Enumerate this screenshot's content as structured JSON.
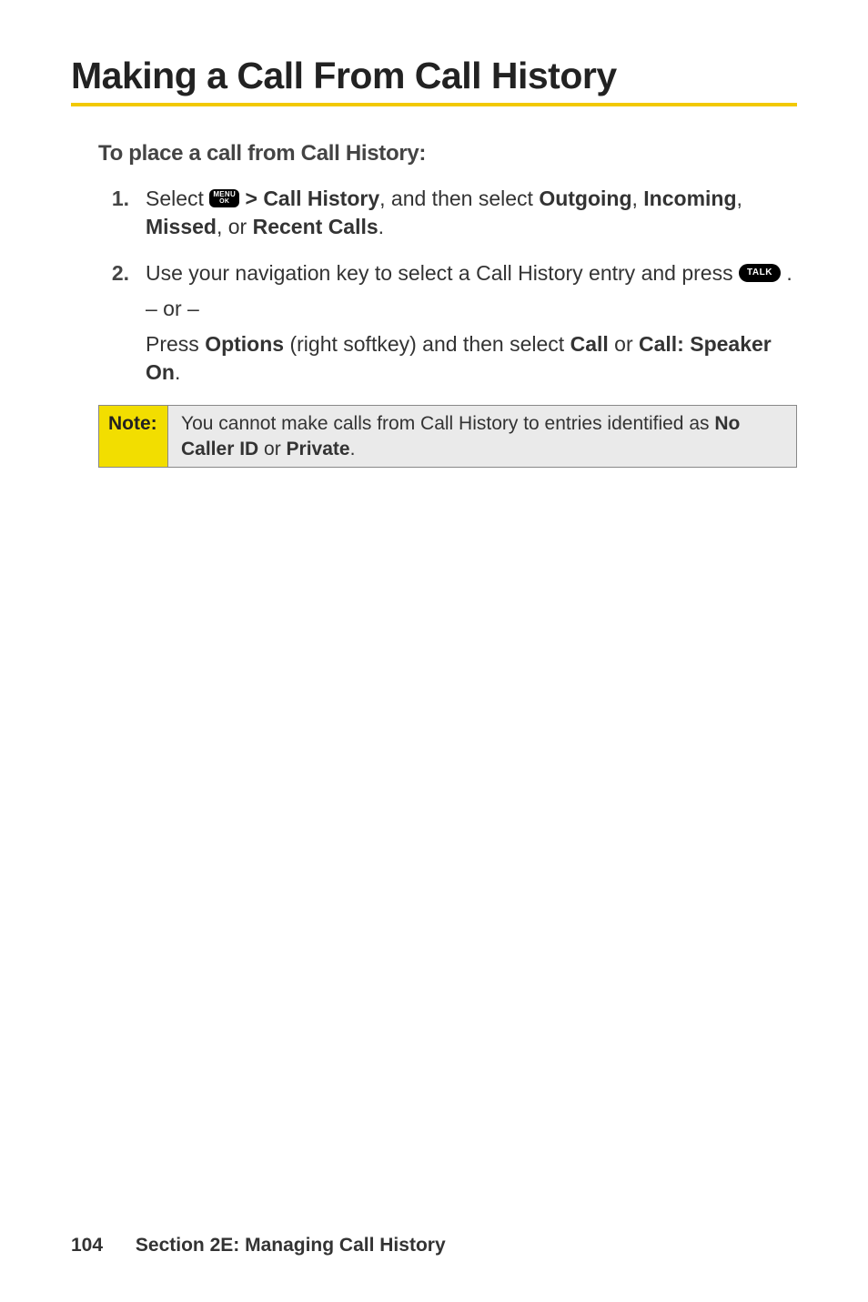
{
  "title": "Making a Call From Call History",
  "subheading": "To place a call from Call History:",
  "steps": {
    "s1": {
      "num": "1.",
      "pre": "Select ",
      "icon_menu_l1": "MENU",
      "icon_menu_l2": "OK",
      "mid1": " > ",
      "bold1": "Call History",
      "mid2": ", and then select ",
      "bold2": "Outgoing",
      "mid3": ", ",
      "bold3": "Incoming",
      "mid4": ", ",
      "bold4": "Missed",
      "mid5": ", or ",
      "bold5": "Recent Calls",
      "end": "."
    },
    "s2": {
      "num": "2.",
      "line1a": "Use your navigation key to select a Call History entry and press ",
      "icon_talk": "TALK",
      "line1b": " .",
      "or": "– or –",
      "line2a": "Press ",
      "bold_options": "Options",
      "line2b": " (right softkey) and then select ",
      "bold_call": "Call",
      "line2c": " or ",
      "bold_speaker": "Call: Speaker On",
      "line2d": "."
    }
  },
  "note": {
    "label": "Note:",
    "text_a": "You cannot make calls from Call History to entries identified as ",
    "bold1": "No Caller ID",
    "text_b": " or ",
    "bold2": "Private",
    "text_c": "."
  },
  "footer": {
    "page": "104",
    "section": "Section 2E: Managing Call History"
  }
}
